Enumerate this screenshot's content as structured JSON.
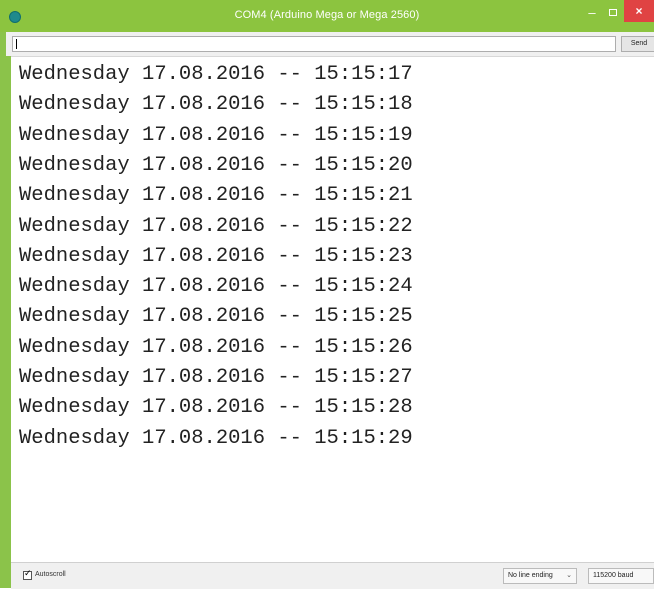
{
  "window": {
    "title": "COM4 (Arduino Mega or Mega 2560)",
    "minimize": "–",
    "close": "×"
  },
  "input": {
    "value": "",
    "send_label": "Send"
  },
  "output": {
    "lines": [
      "Wednesday 17.08.2016 -- 15:15:17",
      "Wednesday 17.08.2016 -- 15:15:18",
      "Wednesday 17.08.2016 -- 15:15:19",
      "Wednesday 17.08.2016 -- 15:15:20",
      "Wednesday 17.08.2016 -- 15:15:21",
      "Wednesday 17.08.2016 -- 15:15:22",
      "Wednesday 17.08.2016 -- 15:15:23",
      "Wednesday 17.08.2016 -- 15:15:24",
      "Wednesday 17.08.2016 -- 15:15:25",
      "Wednesday 17.08.2016 -- 15:15:26",
      "Wednesday 17.08.2016 -- 15:15:27",
      "Wednesday 17.08.2016 -- 15:15:28",
      "Wednesday 17.08.2016 -- 15:15:29"
    ]
  },
  "statusbar": {
    "autoscroll_label": "Autoscroll",
    "autoscroll_checked": true,
    "line_ending": "No line ending",
    "baud": "115200 baud"
  },
  "colors": {
    "titlebar": "#8cc43f",
    "close_button": "#e04343"
  }
}
